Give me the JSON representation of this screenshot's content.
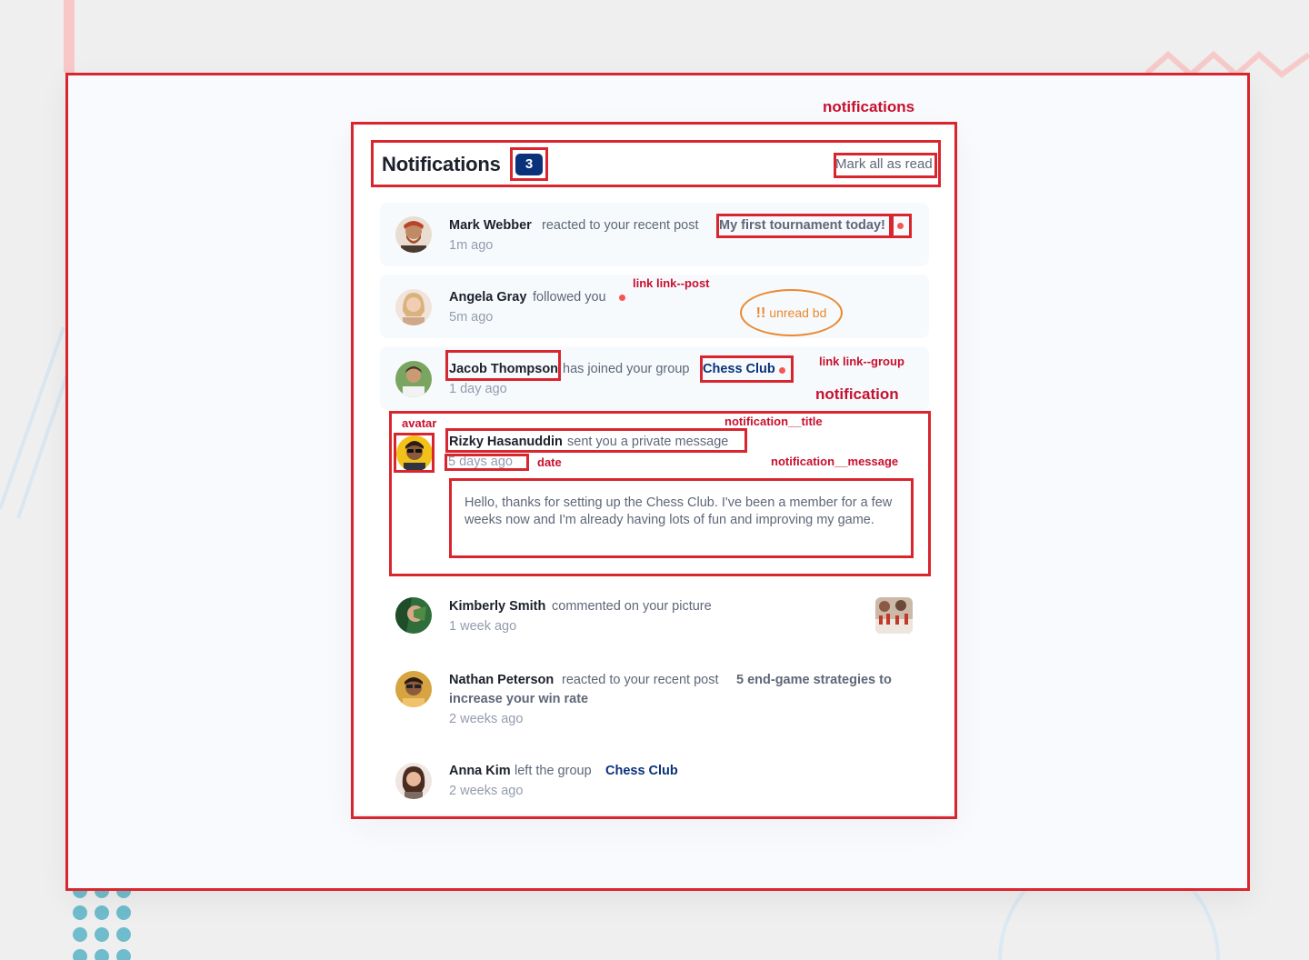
{
  "header": {
    "title": "Notifications",
    "count": "3",
    "mark_all": "Mark all as read"
  },
  "notifications": [
    {
      "name": "Mark Webber",
      "action": "reacted to your recent post",
      "target": "My first tournament today!",
      "time": "1m ago"
    },
    {
      "name": "Angela Gray",
      "action": "followed you",
      "time": "5m ago"
    },
    {
      "name": "Jacob Thompson",
      "action": "has joined your group",
      "target": "Chess Club",
      "time": "1 day ago"
    },
    {
      "name": "Rizky Hasanuddin",
      "action": "sent you a private message",
      "time": "5 days ago",
      "message": "Hello, thanks for setting up the Chess Club. I've been a member for a few weeks now and I'm already having lots of fun and improving my game."
    },
    {
      "name": "Kimberly Smith",
      "action": "commented on your picture",
      "time": "1 week ago"
    },
    {
      "name": "Nathan Peterson",
      "action": "reacted to your recent post",
      "target_line1": "5 end-game strategies to",
      "target_line2": "increase your win rate",
      "time": "2 weeks ago"
    },
    {
      "name": "Anna Kim",
      "action": "left the group",
      "target": "Chess Club",
      "time": "2 weeks ago"
    }
  ],
  "annotations": {
    "notifications": "notifications",
    "link_post": "link link--post",
    "unread_mark": "!!",
    "unread": "unread bd",
    "link_group": "link link--group",
    "notification": "notification",
    "avatar": "avatar",
    "title": "notification__title",
    "date": "date",
    "message": "notification__message"
  },
  "colors": {
    "annotation": "#d9262e",
    "badge": "#0a327b",
    "unread_dot": "#f65552",
    "unread_bg": "#f7fafd",
    "oval": "#e9892f"
  }
}
